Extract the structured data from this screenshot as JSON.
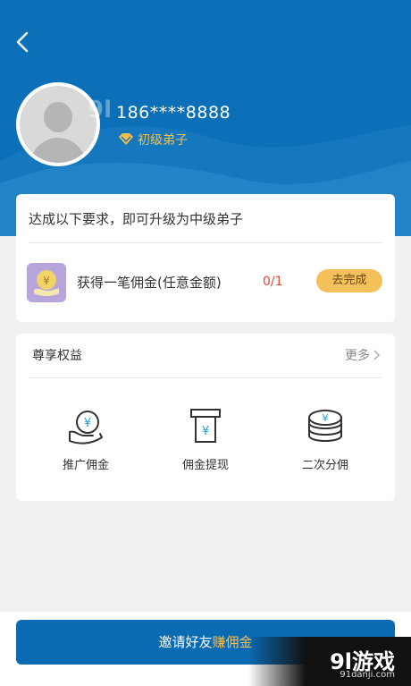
{
  "profile": {
    "phone": "186****8888",
    "level": "初级弟子"
  },
  "upgrade": {
    "title": "达成以下要求，即可升级为中级弟子",
    "task": {
      "label": "获得一笔佣金(任意金额)",
      "progress": "0/1",
      "action": "去完成"
    }
  },
  "benefits": {
    "title": "尊享权益",
    "more": "更多",
    "items": [
      {
        "label": "推广佣金",
        "icon": "hand-yen-icon"
      },
      {
        "label": "佣金提现",
        "icon": "atm-withdraw-icon"
      },
      {
        "label": "二次分佣",
        "icon": "coin-stack-icon"
      }
    ]
  },
  "invite": {
    "prefix": "邀请好友",
    "highlight": "赚佣金"
  },
  "watermark": {
    "logo": "9l游戏",
    "url": "91danji.com"
  },
  "colors": {
    "header_blue": "#0c70b8",
    "gold": "#f3c05a",
    "progress_red": "#e5483a"
  }
}
